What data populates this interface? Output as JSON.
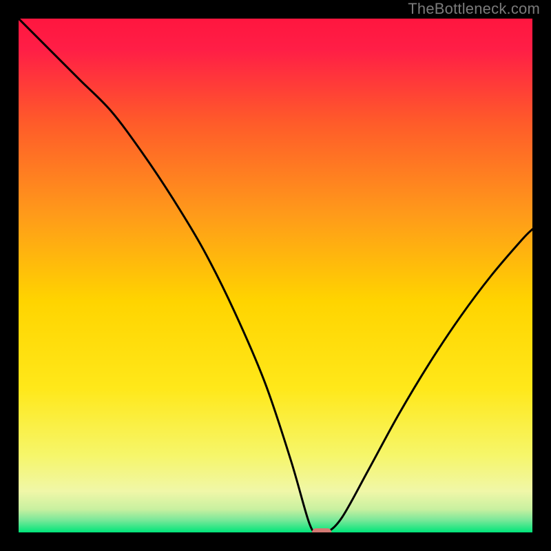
{
  "watermark": "TheBottleneck.com",
  "chart_data": {
    "type": "line",
    "title": "",
    "xlabel": "",
    "ylabel": "",
    "xlim": [
      0,
      100
    ],
    "ylim": [
      0,
      100
    ],
    "grid": false,
    "legend": false,
    "gradient_colors": {
      "top": "#ff1a4b",
      "upper_mid": "#ff6a2a",
      "mid": "#ffd400",
      "lower_mid": "#f5f77a",
      "bottom": "#00e57a"
    },
    "series": [
      {
        "name": "bottleneck-curve",
        "x": [
          0,
          6,
          12,
          18,
          24,
          30,
          36,
          42,
          48,
          53,
          56.5,
          58,
          60,
          63,
          68,
          74,
          80,
          86,
          92,
          98,
          100
        ],
        "y": [
          100,
          94,
          88,
          82,
          74,
          65,
          55,
          43,
          29,
          14,
          2,
          0,
          0,
          3,
          12,
          23,
          33,
          42,
          50,
          57,
          59
        ]
      }
    ],
    "marker": {
      "name": "optimal-point",
      "x": 59,
      "y": 0,
      "color": "#d47a74",
      "width": 3.8,
      "height": 1.6
    }
  }
}
